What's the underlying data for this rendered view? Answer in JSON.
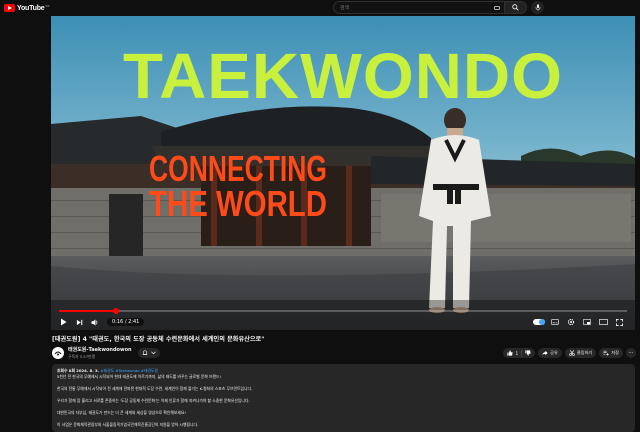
{
  "header": {
    "logo_text": "YouTube",
    "region": "KR",
    "search_placeholder": "검색",
    "icons": [
      "keyboard-icon",
      "search-icon",
      "mic-icon"
    ]
  },
  "video": {
    "overlay_title": "TAEKWONDO",
    "overlay_subtitle_line1": "CONNECTING",
    "overlay_subtitle_line2": "THE WORLD",
    "current_time": "0:16 / 2:41",
    "progress_fraction": 0.1,
    "accent_overlay_green": "#c8f03c",
    "accent_overlay_red": "#ff4a1a"
  },
  "title": "[태권도원] 4 \"태권도, 한국의 도장 공동체 수련문화에서 세계인의 문화유산으로\"",
  "channel": {
    "name": "태권도원-Taekwondowon",
    "subscribers": "구독자 3.57만명"
  },
  "actions": {
    "like_count": "1",
    "share": "공유",
    "save_clip": "클립하기",
    "save": "저장"
  },
  "description": {
    "meta": "조회수 8회  2024. 8. 3.",
    "tags": "#태권도 #Taekwondo #태권도원",
    "lines": [
      "5천년 전 한국의 무예에서 시작되어 현대 태권도에 이르기까지, 삶의 태도를 바꾸는 글로벌 문화 브랜드!",
      "한국의 전통 무예에서 시작되어 전 세계에 전파된 현대적 도장 수련, 세계인이 함께 즐기는 K-컬처의 스포츠 무브먼트입니다.",
      "우리가 함께 땀 흘리고 서로를 존중하는 '도장 공동체 수련문화'는 이제 인류가 함께 지켜나가야 할 소중한 문화유산입니다.",
      "대한민국의 자부심, 태권도가 만드는 더 큰 세계와 세상을 영상으로 확인해보세요!",
      "이 사업은 문화체육관광부와 서울올림픽기념국민체육진흥공단의 지원을 받아 시행됩니다."
    ]
  }
}
